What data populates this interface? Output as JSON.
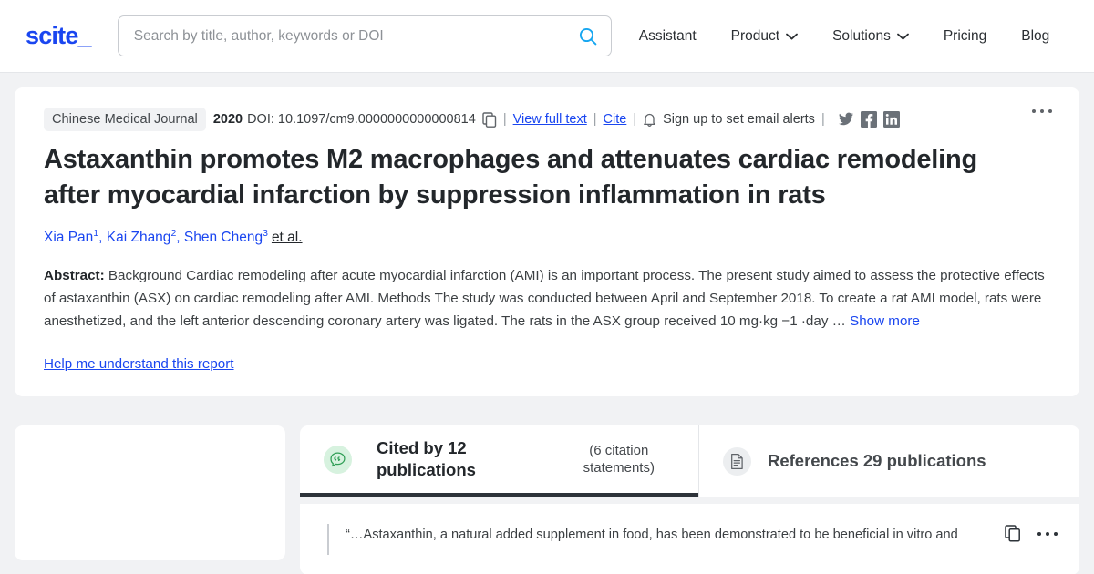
{
  "header": {
    "logo": "scite_",
    "search": {
      "placeholder": "Search by title, author, keywords or DOI",
      "value": "",
      "icon": "search-icon"
    },
    "nav": [
      {
        "label": "Assistant",
        "has_chevron": false
      },
      {
        "label": "Product",
        "has_chevron": true
      },
      {
        "label": "Solutions",
        "has_chevron": true
      },
      {
        "label": "Pricing",
        "has_chevron": false
      },
      {
        "label": "Blog",
        "has_chevron": false
      }
    ]
  },
  "article": {
    "journal": "Chinese Medical Journal",
    "year": "2020",
    "doi": "DOI: 10.1097/cm9.0000000000000814",
    "copy_icon": "copy-icon",
    "view_full_text": "View full text",
    "cite": "Cite",
    "bell_icon": "bell-icon",
    "email_alerts": "Sign up to set email alerts",
    "separator": "|",
    "social": [
      {
        "name": "twitter-icon"
      },
      {
        "name": "facebook-icon"
      },
      {
        "name": "linkedin-icon"
      }
    ],
    "title": "Astaxanthin promotes M2 macrophages and attenuates cardiac remodeling after myocardial infarction by suppression inflammation in rats",
    "authors": [
      {
        "name": "Xia Pan",
        "sup": "1",
        "comma": ","
      },
      {
        "name": "Kai Zhang",
        "sup": "2",
        "comma": ","
      },
      {
        "name": "Shen Cheng",
        "sup": "3",
        "comma": ""
      }
    ],
    "et_al": "et al.",
    "abstract_label": "Abstract:",
    "abstract_text": "Background Cardiac remodeling after acute myocardial infarction (AMI) is an important process. The present study aimed to assess the protective effects of astaxanthin (ASX) on cardiac remodeling after AMI. Methods The study was conducted between April and September 2018. To create a rat AMI model, rats were anesthetized, and the left anterior descending coronary artery was ligated. The rats in the ASX group received 10 mg·kg −1 ·day …",
    "show_more": "Show more",
    "help_link": "Help me understand this report",
    "menu_icon": "kebab-menu-icon"
  },
  "tabs": [
    {
      "id": "cited-by",
      "icon": "quote-bubble-icon",
      "label": "Cited by 12 publications",
      "sub": "(6 citation statements)",
      "active": true
    },
    {
      "id": "references",
      "icon": "document-icon",
      "label": "References 29 publications",
      "sub": "",
      "active": false
    }
  ],
  "citation": {
    "text": "“…Astaxanthin, a natural added supplement in food, has been demonstrated to be beneficial in vitro and",
    "copy_icon": "copy-icon",
    "menu_icon": "kebab-menu-icon"
  },
  "colors": {
    "brand_blue": "#1a46f0",
    "search_icon_blue": "#16a6f0",
    "page_bg": "#f1f2f4",
    "card_bg": "#ffffff",
    "text_dark": "#23272b",
    "text_body": "#3c4043",
    "tab_active_underline": "#2d3339",
    "tab_icon_green": "#d7f2df",
    "quote_green": "#2f9e55"
  }
}
